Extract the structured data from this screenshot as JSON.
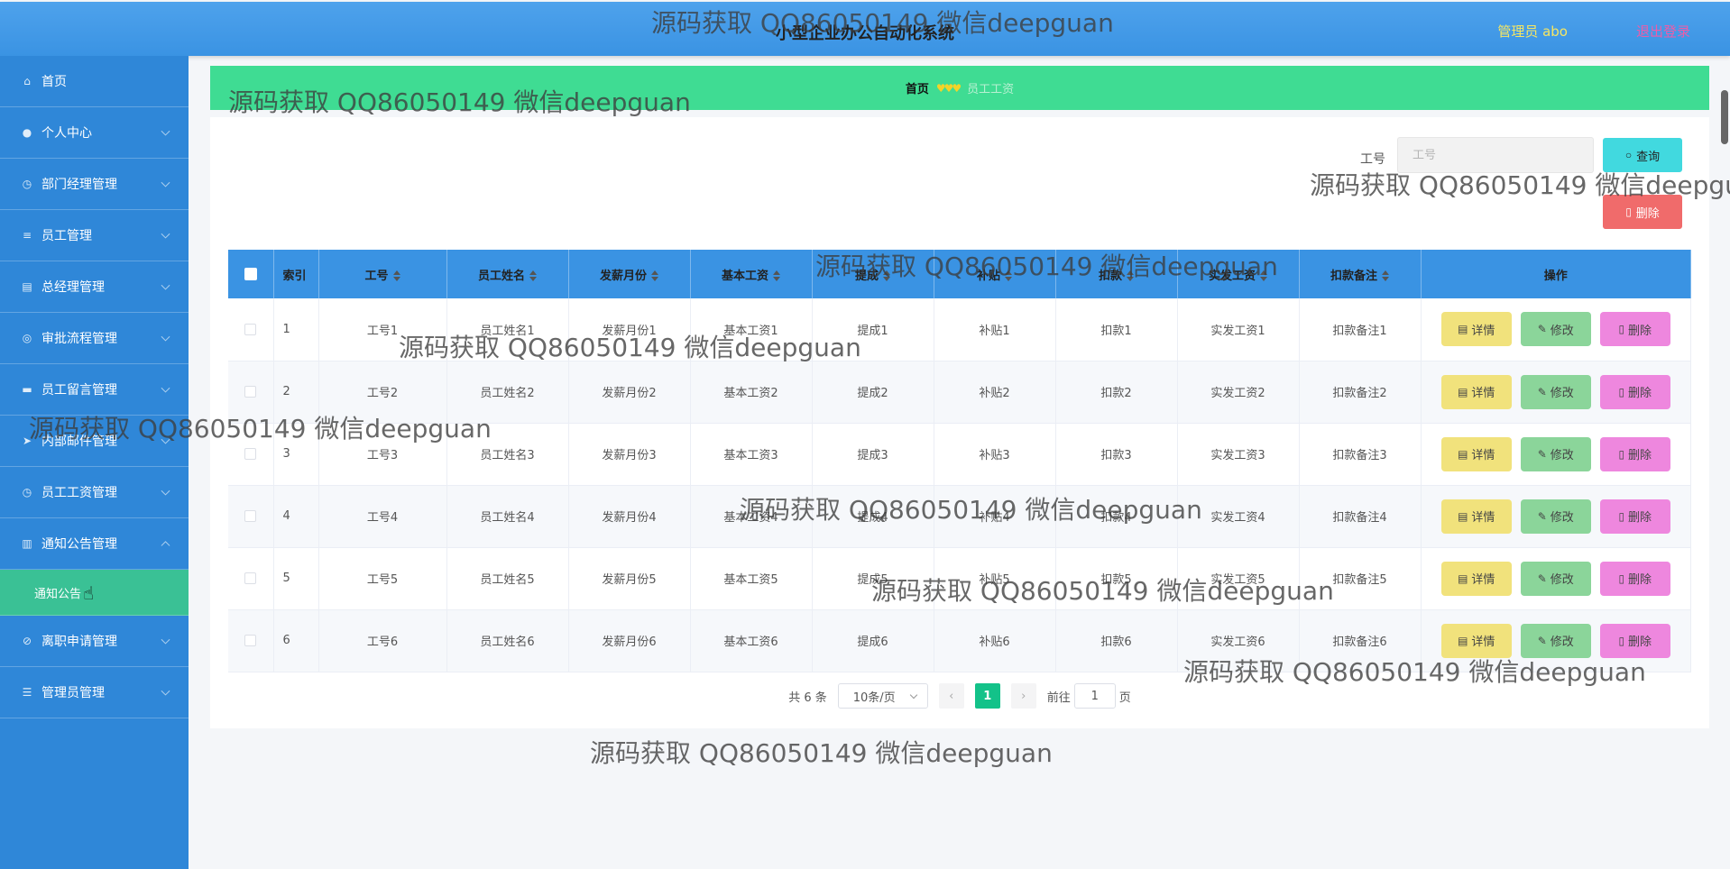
{
  "header": {
    "title": "小型企业办公自动化系统",
    "user": "管理员 abo",
    "logout": "退出登录"
  },
  "sidebar": {
    "items": [
      {
        "label": "首页",
        "icon": "home-icon"
      },
      {
        "label": "个人中心",
        "icon": "user-icon"
      },
      {
        "label": "部门经理管理",
        "icon": "clock-icon"
      },
      {
        "label": "员工管理",
        "icon": "list-icon"
      },
      {
        "label": "总经理管理",
        "icon": "clipboard-icon"
      },
      {
        "label": "审批流程管理",
        "icon": "compass-icon"
      },
      {
        "label": "员工留言管理",
        "icon": "chat-icon"
      },
      {
        "label": "内部邮件管理",
        "icon": "send-icon"
      },
      {
        "label": "员工工资管理",
        "icon": "clock-icon"
      },
      {
        "label": "通知公告管理",
        "icon": "bank-icon"
      },
      {
        "label": "离职申请管理",
        "icon": "ban-icon"
      },
      {
        "label": "管理员管理",
        "icon": "message-icon"
      }
    ],
    "submenu": {
      "label": "通知公告"
    }
  },
  "breadcrumb": {
    "home": "首页",
    "current": "员工工资"
  },
  "search": {
    "label": "工号",
    "placeholder": "工号",
    "query_label": "查询",
    "delete_label": "删除"
  },
  "table": {
    "headers": [
      "索引",
      "工号",
      "员工姓名",
      "发薪月份",
      "基本工资",
      "提成",
      "补贴",
      "扣款",
      "实发工资",
      "扣款备注",
      "操作"
    ],
    "rows": [
      [
        "1",
        "工号1",
        "员工姓名1",
        "发薪月份1",
        "基本工资1",
        "提成1",
        "补贴1",
        "扣款1",
        "实发工资1",
        "扣款备注1"
      ],
      [
        "2",
        "工号2",
        "员工姓名2",
        "发薪月份2",
        "基本工资2",
        "提成2",
        "补贴2",
        "扣款2",
        "实发工资2",
        "扣款备注2"
      ],
      [
        "3",
        "工号3",
        "员工姓名3",
        "发薪月份3",
        "基本工资3",
        "提成3",
        "补贴3",
        "扣款3",
        "实发工资3",
        "扣款备注3"
      ],
      [
        "4",
        "工号4",
        "员工姓名4",
        "发薪月份4",
        "基本工资4",
        "提成4",
        "补贴4",
        "扣款4",
        "实发工资4",
        "扣款备注4"
      ],
      [
        "5",
        "工号5",
        "员工姓名5",
        "发薪月份5",
        "基本工资5",
        "提成5",
        "补贴5",
        "扣款5",
        "实发工资5",
        "扣款备注5"
      ],
      [
        "6",
        "工号6",
        "员工姓名6",
        "发薪月份6",
        "基本工资6",
        "提成6",
        "补贴6",
        "扣款6",
        "实发工资6",
        "扣款备注6"
      ]
    ],
    "ops": {
      "detail": "详情",
      "edit": "修改",
      "delete": "删除"
    }
  },
  "pagination": {
    "total": "共 6 条",
    "page_size": "10条/页",
    "current_page": "1",
    "goto_prefix": "前往",
    "goto_value": "1",
    "goto_suffix": "页"
  },
  "watermark": "源码获取 QQ86050149 微信deepguan",
  "colors": {
    "header": "#3a93e3",
    "sidebar": "#2f87d8",
    "breadcrumb": "#3fdc93",
    "submenu_active": "#3ac195",
    "query_button": "#41d9df",
    "delete_button": "#f06b6b",
    "detail_button": "#f1e27c",
    "edit_button": "#8bd59a",
    "row_delete_button": "#ee87de",
    "page_active": "#13c289"
  }
}
